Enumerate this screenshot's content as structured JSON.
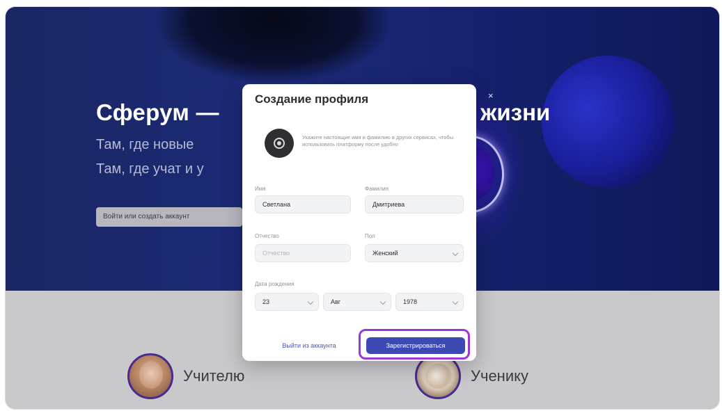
{
  "hero": {
    "title_left": "Сферум —",
    "title_right": "жизни",
    "subtitle_line1": "Там, где новые",
    "subtitle_line2": "Там, где учат и у",
    "cta_label": "Войти или создать аккаунт",
    "close_symbol": "×"
  },
  "modal": {
    "title": "Создание профиля",
    "photo_hint": "Укажите настоящие имя и фамилию в других сервисах, чтобы использовать платформу после удобно",
    "fields": {
      "first_name": {
        "label": "Имя",
        "value": "Светлана"
      },
      "last_name": {
        "label": "Фамилия",
        "value": "Дмитриева"
      },
      "patronymic": {
        "label": "Отчество",
        "placeholder": "Отчество"
      },
      "gender": {
        "label": "Пол",
        "value": "Женский"
      },
      "birth_date": {
        "label": "Дата рождения",
        "day": "23",
        "month": "Авг",
        "year": "1978"
      }
    },
    "logout_label": "Выйти из аккаунта",
    "register_label": "Зарегистрироваться",
    "highlight_color": "#9c37d6",
    "primary_color": "#3e4ab3"
  },
  "roles": {
    "teacher": "Учителю",
    "student": "Ученику"
  }
}
